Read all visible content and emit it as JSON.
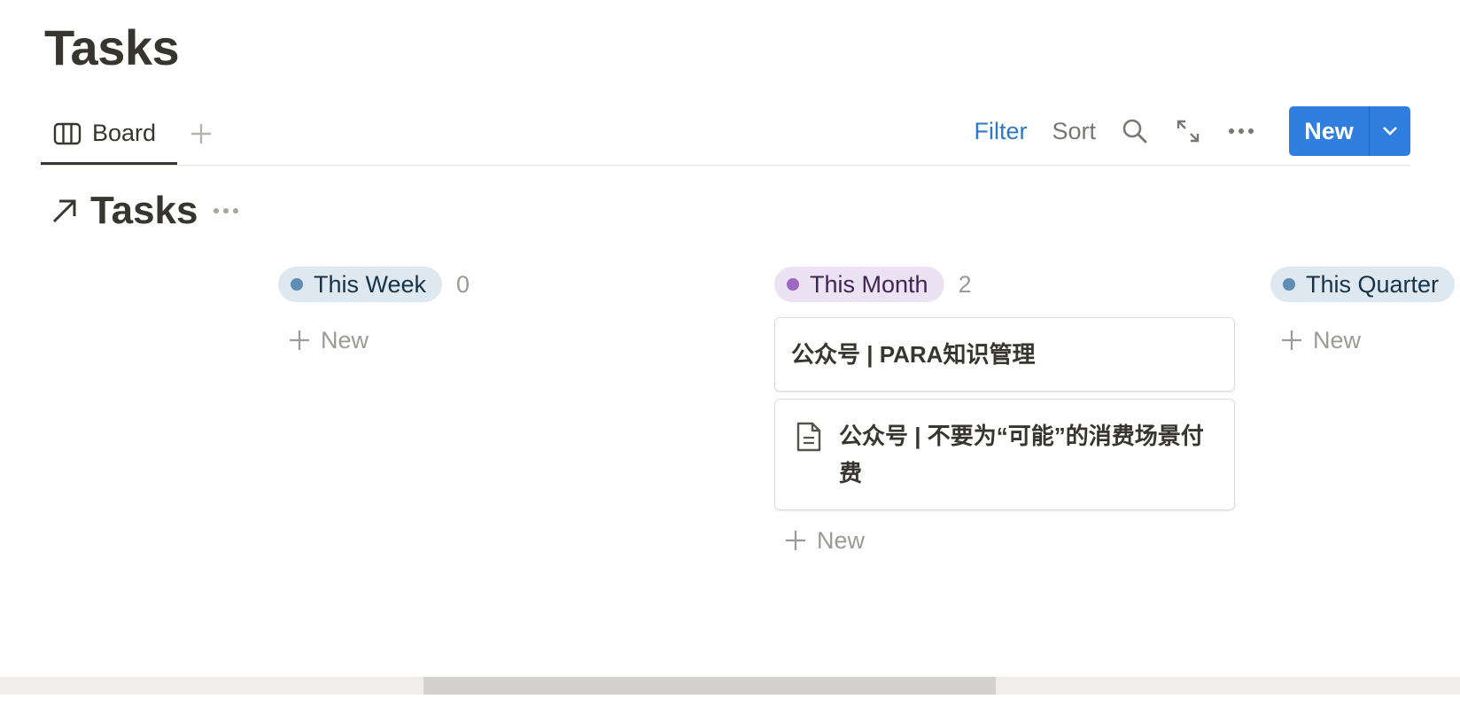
{
  "page": {
    "title": "Tasks"
  },
  "view_bar": {
    "tabs": [
      {
        "label": "Board",
        "icon": "board-icon",
        "active": true
      }
    ],
    "add_view_icon": "plus-icon",
    "filter_label": "Filter",
    "sort_label": "Sort",
    "search_icon": "search-icon",
    "expand_icon": "expand-icon",
    "more_icon": "more-horizontal-icon",
    "new_label": "New",
    "new_dropdown_icon": "chevron-down-icon"
  },
  "linked_db": {
    "icon": "arrow-up-right-icon",
    "title": "Tasks",
    "more_icon": "more-horizontal-icon"
  },
  "board": {
    "new_item_label": "New",
    "columns": [
      {
        "label": "This Week",
        "count": "0",
        "dot_color": "#5f8db3",
        "pill_bg": "#dde8f0",
        "text_color": "#183347",
        "cards": []
      },
      {
        "label": "This Month",
        "count": "2",
        "dot_color": "#9d68c2",
        "pill_bg": "#ebe2f3",
        "text_color": "#412454",
        "cards": [
          {
            "title": "公众号 | PARA知识管理",
            "has_icon": false
          },
          {
            "title": "公众号 | 不要为“可能”的消费场景付费",
            "has_icon": true,
            "icon": "document-icon"
          }
        ]
      },
      {
        "label": "This Quarter",
        "count": "",
        "dot_color": "#5f8db3",
        "pill_bg": "#dde8f0",
        "text_color": "#183347",
        "cards": []
      }
    ]
  },
  "colors": {
    "accent": "#2f7ee0",
    "filter_text": "#2f78c4",
    "muted_text": "#9b9a97",
    "primary_text": "#37352f"
  }
}
